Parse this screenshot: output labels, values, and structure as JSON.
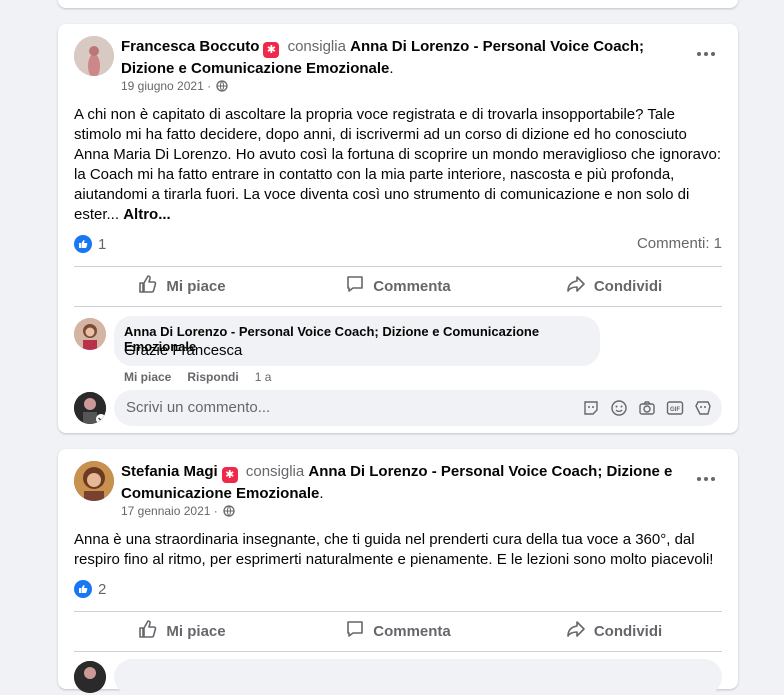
{
  "post1": {
    "author": "Francesca Boccuto",
    "verb": "consiglia",
    "page": "Anna Di Lorenzo - Personal Voice Coach; Dizione e Comunicazione Emozionale",
    "period": ".",
    "date": "19 giugno 2021 ·",
    "body": "A chi non è capitato di ascoltare la propria voce registrata e di trovarla insopportabile? Tale stimolo mi ha fatto decidere, dopo anni, di iscrivermi ad un corso di dizione ed ho conosciuto Anna Maria Di Lorenzo. Ho avuto così la fortuna di scoprire un mondo meraviglioso che ignoravo: la Coach mi ha fatto entrare in contatto con la mia parte interiore, nascosta e più profonda, aiutandomi a tirarla fuori. La voce diventa così uno strumento di comunicazione e non solo di ester...",
    "more_label": "Altro...",
    "likes": "1",
    "comments": "Commenti: 1",
    "reply": {
      "author": "Anna Di Lorenzo - Personal Voice Coach; Dizione e Comunicazione Emozionale",
      "text": "Grazie Francesca",
      "like_label": "Mi piace",
      "reply_label": "Rispondi",
      "time": "1 a"
    }
  },
  "post2": {
    "author": "Stefania Magi",
    "verb": "consiglia",
    "page": "Anna Di Lorenzo - Personal Voice Coach; Dizione e Comunicazione Emozionale",
    "period": ".",
    "date": "17 gennaio 2021 ·",
    "body": "Anna è una straordinaria insegnante, che ti guida nel prenderti cura della tua voce a 360°, dal respiro fino al ritmo, per esprimerti naturalmente e pienamente. E le lezioni sono molto piacevoli!",
    "likes": "2"
  },
  "actions": {
    "like": "Mi piace",
    "comment": "Commenta",
    "share": "Condividi"
  },
  "comment_input": {
    "placeholder": "Scrivi un commento..."
  },
  "colors": {
    "accent": "#1877f2",
    "recommend_badge": "#f02849"
  },
  "icons": [
    "recommend-badge-icon",
    "globe-icon",
    "more-icon",
    "like-icon",
    "thumbs-up-icon",
    "comment-icon",
    "share-icon",
    "sticker-icon",
    "emoji-icon",
    "camera-icon",
    "gif-icon",
    "avatar-sticker-icon"
  ]
}
